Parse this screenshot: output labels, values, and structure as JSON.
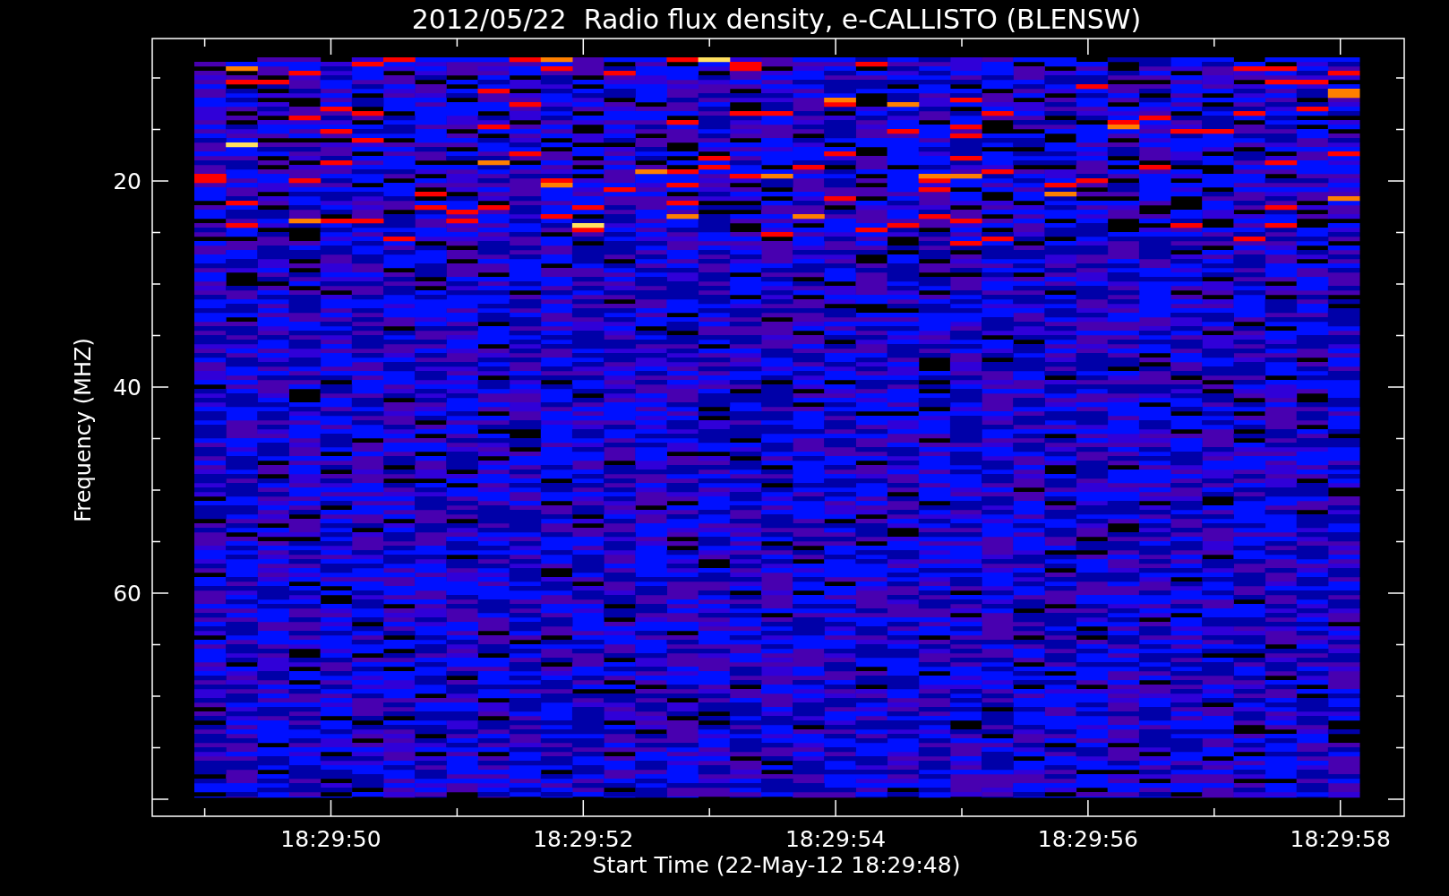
{
  "title": "2012/05/22  Radio flux density, e-CALLISTO (BLENSW)",
  "y_axis": {
    "label": "Frequency (MHZ)",
    "ticks": [
      "20",
      "40",
      "60"
    ]
  },
  "x_axis": {
    "label": "Start Time (22-May-12 18:29:48)",
    "ticks": [
      "18:29:50",
      "18:29:52",
      "18:29:54",
      "18:29:56",
      "18:29:58"
    ]
  }
}
